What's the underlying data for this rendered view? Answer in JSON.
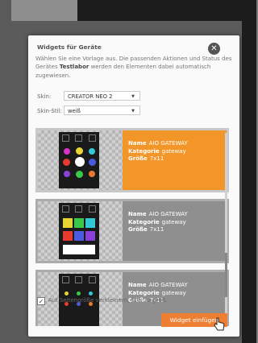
{
  "dialog": {
    "title": "Widgets für Geräte",
    "desc_pre": "Wählen Sie eine Vorlage aus. Die passenden Aktionen und Status des Gerätes ",
    "device_name": "Testlabor",
    "desc_post": " werden den Elementen dabei automatisch zugewiesen.",
    "skin_label": "Skin:",
    "skin_value": "CREATOR NEO 2",
    "skin_style_label": "Skin-Stil:",
    "skin_style_value": "weiß",
    "checkbox_label": "Auf Seitengröße verkleinern, falls zu groß.",
    "checkbox_checked": true,
    "insert_button": "Widget einfügen"
  },
  "widgets": [
    {
      "name_label": "Name",
      "name": "AIO GATEWAY",
      "category_label": "Kategorie",
      "category": "gateway",
      "size_label": "Größe",
      "size": "7x11",
      "selected": true
    },
    {
      "name_label": "Name",
      "name": "AIO GATEWAY",
      "category_label": "Kategorie",
      "category": "gateway",
      "size_label": "Größe",
      "size": "7x11",
      "selected": false
    },
    {
      "name_label": "Name",
      "name": "AIO GATEWAY",
      "category_label": "Kategorie",
      "category": "gateway",
      "size_label": "Größe",
      "size": "7x11",
      "selected": false
    }
  ],
  "colors": {
    "accent": "#ee7f32",
    "selected_card": "#f2962a",
    "card": "#8f8f8f"
  }
}
